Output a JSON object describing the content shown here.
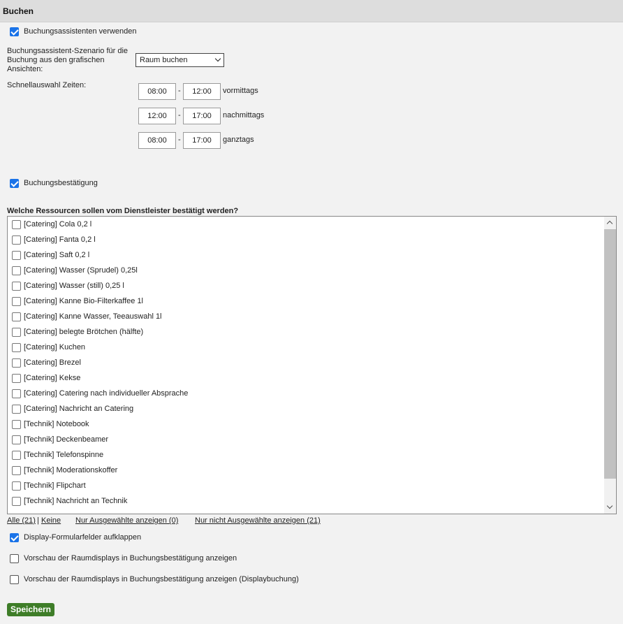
{
  "section": {
    "title": "Buchen"
  },
  "wizard": {
    "checked": true,
    "label": "Buchungsassistenten verwenden"
  },
  "scenario": {
    "label_lines": [
      "Buchungsassistent-Szenario für die",
      "Buchung aus den grafischen",
      "Ansichten:"
    ],
    "selected": "Raum buchen"
  },
  "quick_times": {
    "label": "Schnellauswahl Zeiten:",
    "dash": "-",
    "rows": [
      {
        "from": "08:00",
        "to": "12:00",
        "name": "vormittags"
      },
      {
        "from": "12:00",
        "to": "17:00",
        "name": "nachmittags"
      },
      {
        "from": "08:00",
        "to": "17:00",
        "name": "ganztags"
      }
    ]
  },
  "confirmation": {
    "checked": true,
    "label": "Buchungsbestätigung"
  },
  "resources": {
    "question": "Welche Ressourcen sollen vom Dienstleister bestätigt werden?",
    "items": [
      "[Catering] Cola 0,2 l",
      "[Catering] Fanta 0,2 l",
      "[Catering] Saft 0,2 l",
      "[Catering] Wasser (Sprudel) 0,25l",
      "[Catering] Wasser (still) 0,25 l",
      "[Catering] Kanne Bio-Filterkaffee 1l",
      "[Catering] Kanne Wasser, Teeauswahl 1l",
      "[Catering] belegte Brötchen (hälfte)",
      "[Catering] Kuchen",
      "[Catering] Brezel",
      "[Catering] Kekse",
      "[Catering] Catering nach individueller Absprache",
      "[Catering] Nachricht an Catering",
      "[Technik] Notebook",
      "[Technik] Deckenbeamer",
      "[Technik] Telefonspinne",
      "[Technik] Moderationskoffer",
      "[Technik] Flipchart",
      "[Technik] Nachricht an Technik"
    ]
  },
  "filters": {
    "all": "Alle (21)",
    "separator": "|",
    "none": "Keine",
    "only_selected": "Nur Ausgewählte anzeigen (0)",
    "only_unselected": "Nur nicht Ausgewählte anzeigen (21)"
  },
  "options": [
    {
      "checked": true,
      "label": "Display-Formularfelder aufklappen"
    },
    {
      "checked": false,
      "label": "Vorschau der Raumdisplays in Buchungsbestätigung anzeigen"
    },
    {
      "checked": false,
      "label": "Vorschau der Raumdisplays in Buchungsbestätigung anzeigen (Displaybuchung)"
    }
  ],
  "save_label": "Speichern",
  "colors": {
    "accent": "#1a73e8",
    "save": "#3e7d28",
    "header": "#dddddd"
  }
}
